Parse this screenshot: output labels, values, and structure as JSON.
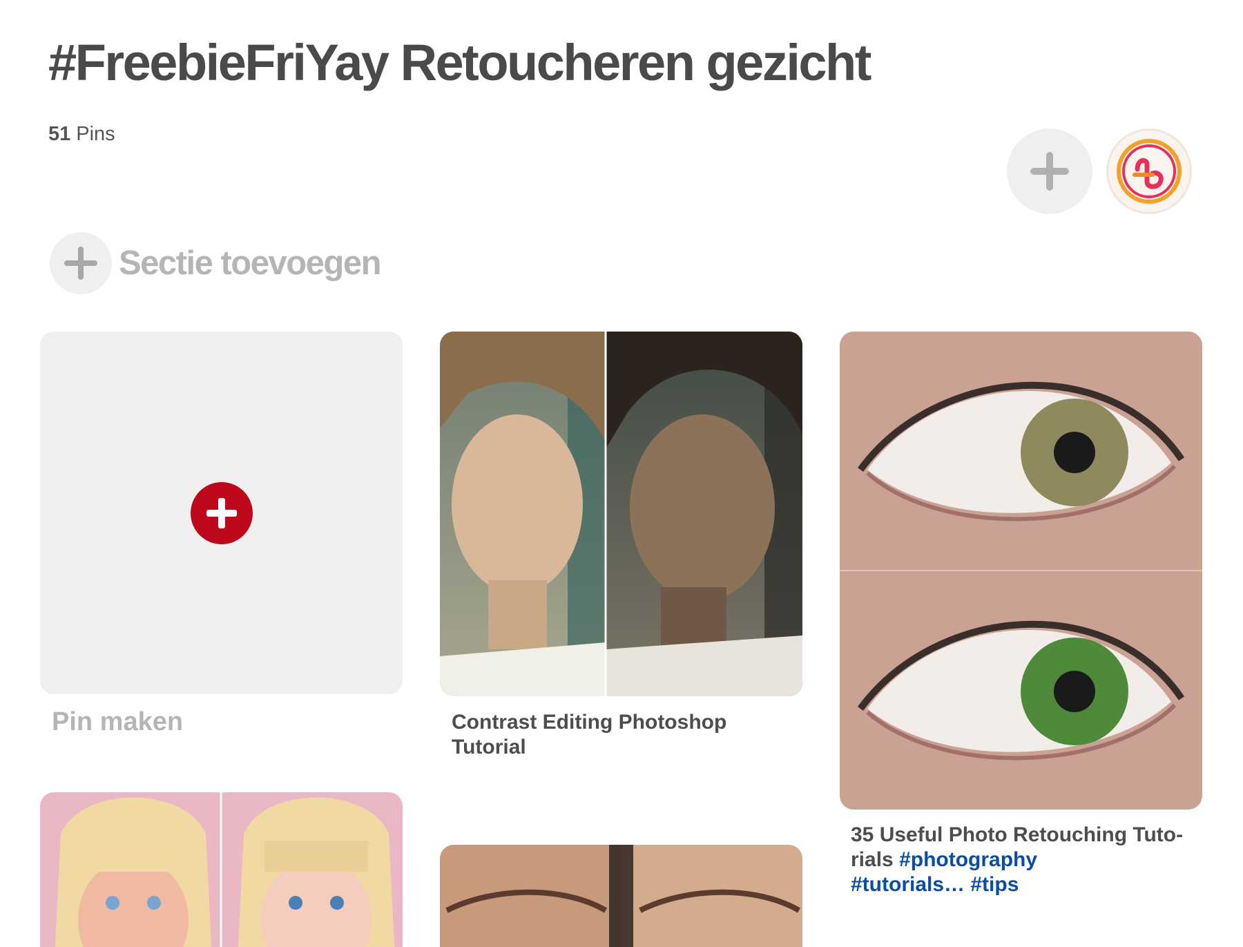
{
  "board": {
    "title": "#FreebieFriYay Retoucheren gezicht",
    "pin_count": "51",
    "pin_count_label": "Pins"
  },
  "actions": {
    "add_section_label": "Sectie toevoegen",
    "create_pin_label": "Pin maken"
  },
  "pins": [
    {
      "description": "Contrast Editing Photoshop Tutorial"
    },
    {
      "description": "35 Useful Photo Retouching Tuto-rials",
      "hashtags": [
        "#photography",
        "#tutorials…",
        "#tips"
      ]
    }
  ],
  "colors": {
    "brand_red": "#bd081c",
    "hashtag_blue": "#0a4ea3",
    "muted_gray": "#b5b5b5"
  }
}
